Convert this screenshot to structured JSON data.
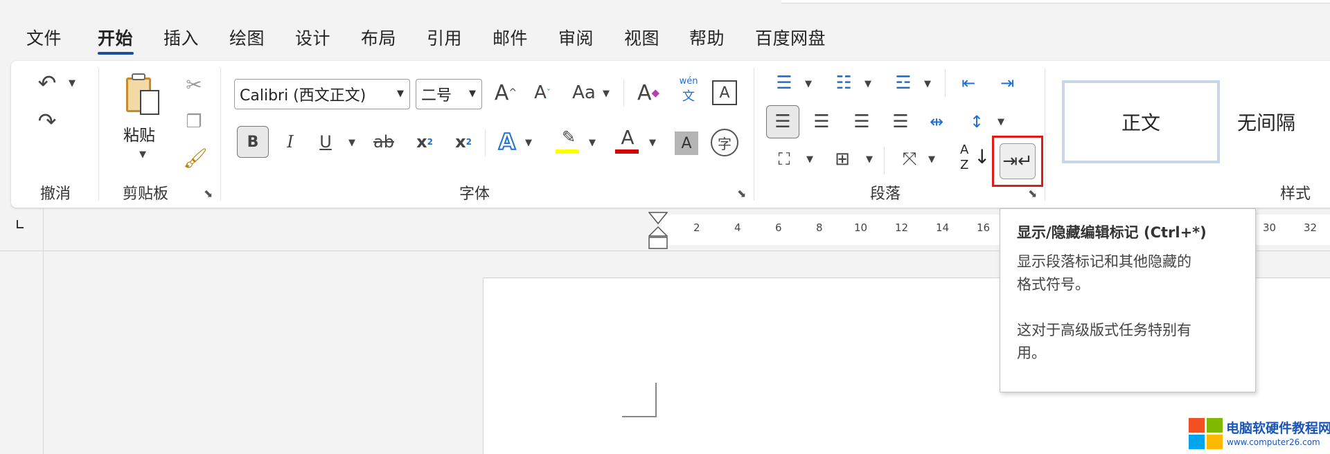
{
  "menu": {
    "tabs": [
      {
        "label": "文件"
      },
      {
        "label": "开始"
      },
      {
        "label": "插入"
      },
      {
        "label": "绘图"
      },
      {
        "label": "设计"
      },
      {
        "label": "布局"
      },
      {
        "label": "引用"
      },
      {
        "label": "邮件"
      },
      {
        "label": "审阅"
      },
      {
        "label": "视图"
      },
      {
        "label": "帮助"
      },
      {
        "label": "百度网盘"
      }
    ],
    "active_tab": "开始"
  },
  "ribbon": {
    "undo_group": {
      "label": "撤消"
    },
    "clipboard_group": {
      "label": "剪贴板",
      "paste_label": "粘贴"
    },
    "font_group": {
      "label": "字体",
      "font_name": "Calibri (西文正文)",
      "font_size": "二号",
      "change_case_label": "Aa",
      "phonetic_top": "wén",
      "phonetic_bottom": "文",
      "bold_glyph": "B",
      "italic_glyph": "I",
      "underline_glyph": "U",
      "strike_glyph": "ab",
      "sub_glyph": "x",
      "sub_mark": "2",
      "sup_glyph": "x",
      "sup_mark": "2",
      "grow_glyph": "A",
      "shrink_glyph": "A",
      "clear_glyph": "A",
      "char_border_glyph": "A",
      "effects_glyph": "A",
      "font_color_glyph": "A",
      "shading_glyph": "A",
      "enclose_glyph": "字",
      "highlight_color": "#ffff00",
      "font_color": "#d40000"
    },
    "paragraph_group": {
      "label": "段落",
      "sort_top": "A",
      "sort_bottom": "Z"
    },
    "styles_group": {
      "label": "样式",
      "style_normal": "正文",
      "style_no_spacing": "无间隔"
    }
  },
  "ruler": {
    "ticks": [
      "2",
      "4",
      "6",
      "8",
      "10",
      "12",
      "14",
      "16",
      "30",
      "32"
    ]
  },
  "tooltip": {
    "title": "显示/隐藏编辑标记 (Ctrl+*)",
    "line1": "显示段落标记和其他隐藏的",
    "line2": "格式符号。",
    "line3": "这对于高级版式任务特别有",
    "line4": "用。"
  },
  "watermark": {
    "title": "电脑软硬件教程网",
    "url": "www.computer26.com"
  },
  "colors": {
    "accent": "#1f4e9c",
    "highlight_box": "#e01919"
  }
}
